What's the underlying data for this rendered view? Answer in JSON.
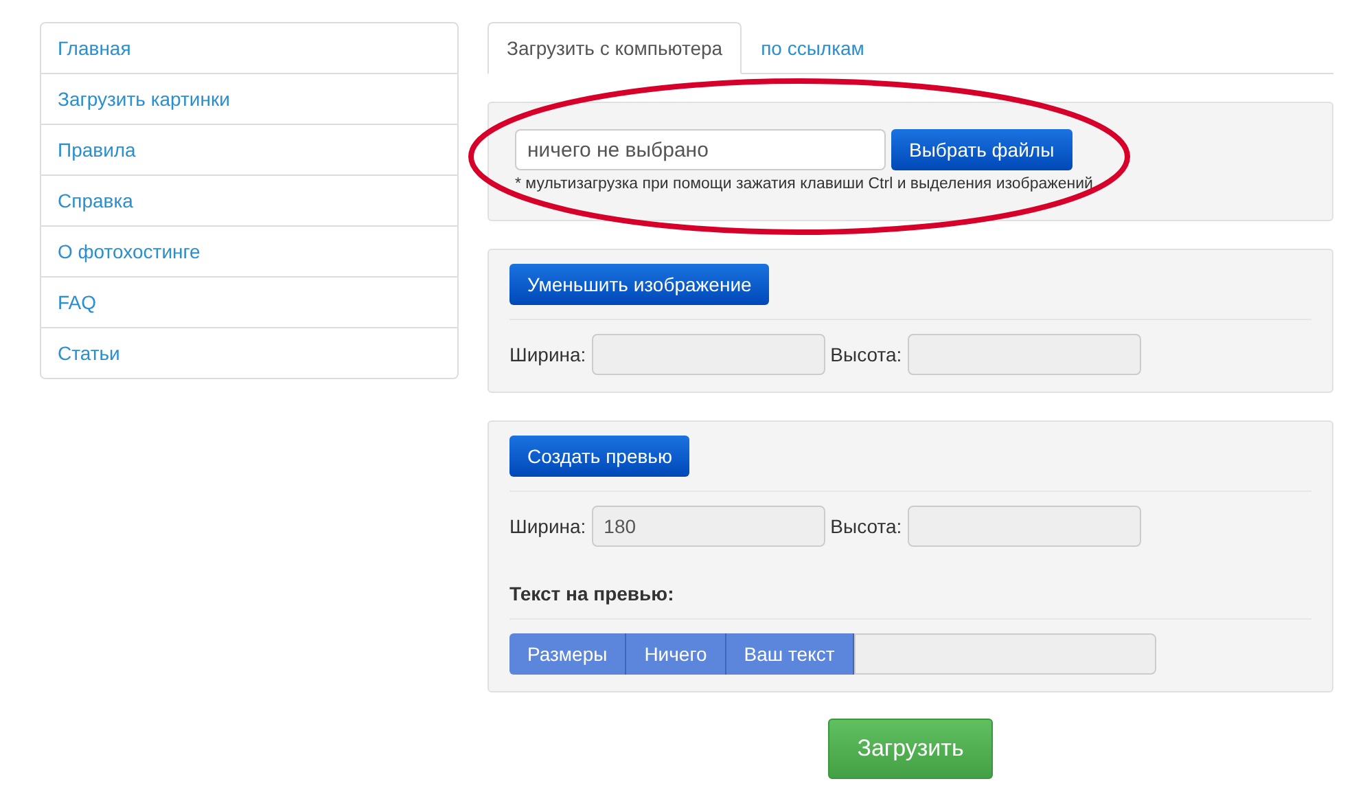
{
  "sidebar": {
    "items": [
      {
        "label": "Главная"
      },
      {
        "label": "Загрузить картинки"
      },
      {
        "label": "Правила"
      },
      {
        "label": "Справка"
      },
      {
        "label": "О фотохостинге"
      },
      {
        "label": "FAQ"
      },
      {
        "label": "Статьи"
      }
    ]
  },
  "tabs": [
    {
      "label": "Загрузить с компьютера",
      "selected": true
    },
    {
      "label": "по ссылкам",
      "selected": false
    }
  ],
  "file_panel": {
    "file_field": {
      "value": "ничего не выбрано"
    },
    "choose_button": "Выбрать файлы",
    "hint": "* мультизагрузка при помощи зажатия клавиши Ctrl и выделения изображений"
  },
  "resize_panel": {
    "button": "Уменьшить изображение",
    "width_label": "Ширина:",
    "height_label": "Высота:"
  },
  "preview_panel": {
    "button": "Создать превью",
    "width_label": "Ширина:",
    "width_value": "180",
    "height_label": "Высота:",
    "text_label": "Текст на превью:",
    "text_options": [
      "Размеры",
      "Ничего",
      "Ваш текст"
    ]
  },
  "submit_button": "Загрузить"
}
